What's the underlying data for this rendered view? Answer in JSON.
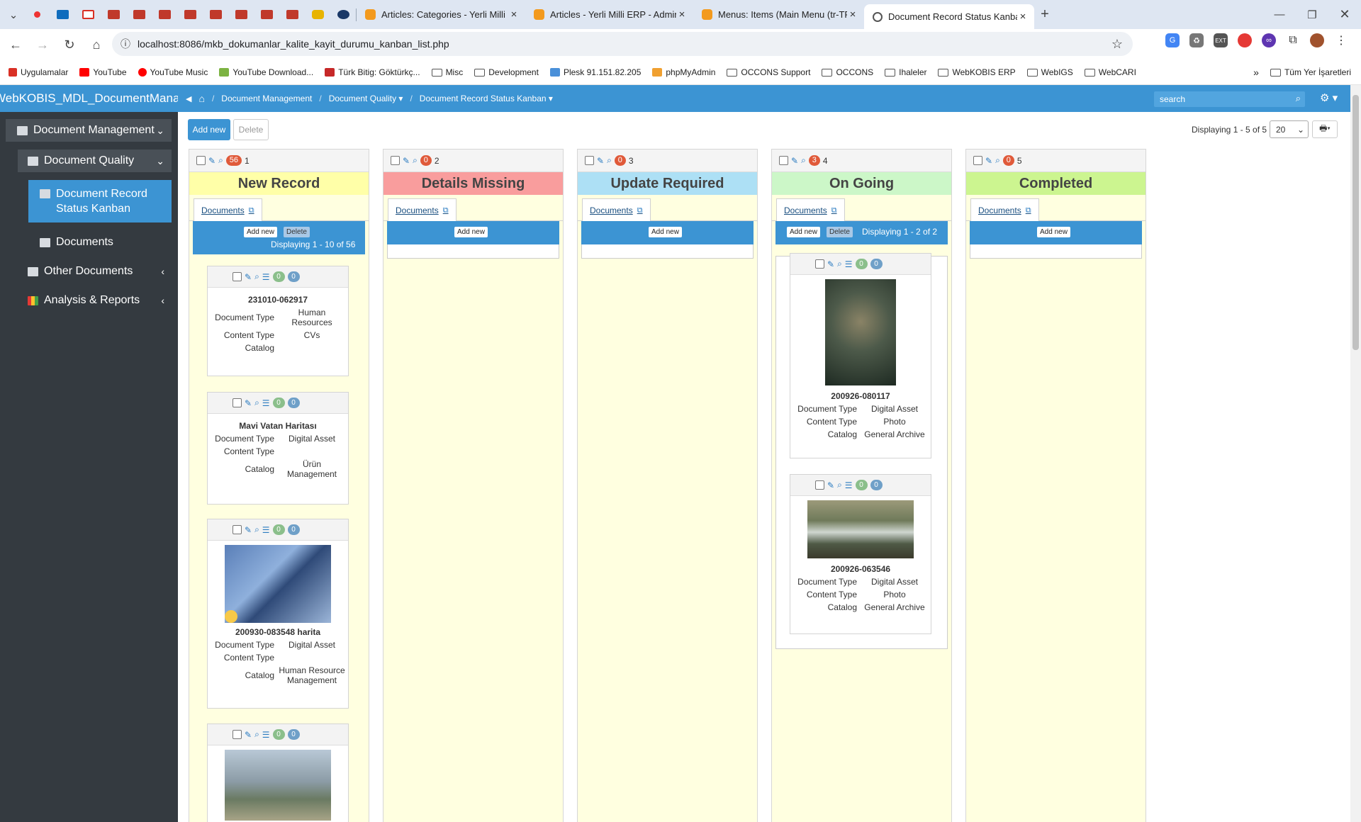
{
  "browser": {
    "tabs": [
      {
        "label": "Articles: Categories - Yerli Milli ERP"
      },
      {
        "label": "Articles - Yerli Milli ERP - Admin"
      },
      {
        "label": "Menus: Items (Main Menu (tr-TR))"
      },
      {
        "label": "Document Record Status Kanban"
      }
    ],
    "new_tab": "+",
    "url": "localhost:8086/mkb_dokumanlar_kalite_kayit_durumu_kanban_list.php"
  },
  "bookmarks": [
    {
      "label": "Uygulamalar"
    },
    {
      "label": "YouTube"
    },
    {
      "label": "YouTube Music"
    },
    {
      "label": "YouTube Download..."
    },
    {
      "label": "Türk Bitig: Göktürkç..."
    },
    {
      "label": "Misc"
    },
    {
      "label": "Development"
    },
    {
      "label": "Plesk 91.151.82.205"
    },
    {
      "label": "phpMyAdmin"
    },
    {
      "label": "OCCONS Support"
    },
    {
      "label": "OCCONS"
    },
    {
      "label": "Ihaleler"
    },
    {
      "label": "WebKOBIS ERP"
    },
    {
      "label": "WebIGS"
    },
    {
      "label": "WebCARI"
    },
    {
      "label": "Tüm Yer İşaretleri"
    }
  ],
  "app": {
    "title": "WebKOBIS_MDL_DocumentManagement",
    "breadcrumbs": [
      "Document Management",
      "Document Quality",
      "Document Record Status Kanban"
    ],
    "search_placeholder": "search"
  },
  "sidebar": {
    "items": [
      {
        "label": "Document Management"
      },
      {
        "label": "Document Quality"
      },
      {
        "label": "Document Record Status Kanban"
      },
      {
        "label": "Documents"
      },
      {
        "label": "Other Documents"
      },
      {
        "label": "Analysis & Reports"
      }
    ]
  },
  "toolbar": {
    "add_new": "Add new",
    "delete": "Delete",
    "displaying": "Displaying 1 - 5 of 5",
    "per_page": "20"
  },
  "columns": [
    {
      "title": "New Record",
      "count": "56",
      "num": "1",
      "color": "#ffffa8",
      "tab": "Documents",
      "add_new": "Add new",
      "delete": "Delete",
      "displaying": "Displaying 1 - 10 of 56"
    },
    {
      "title": "Details Missing",
      "count": "0",
      "num": "2",
      "color": "#f99d9d",
      "tab": "Documents",
      "add_new": "Add new"
    },
    {
      "title": "Update Required",
      "count": "0",
      "num": "3",
      "color": "#ade0f5",
      "tab": "Documents",
      "add_new": "Add new"
    },
    {
      "title": "On Going",
      "count": "3",
      "num": "4",
      "color": "#ccf7c8",
      "tab": "Documents",
      "add_new": "Add new",
      "delete": "Delete",
      "displaying": "Displaying 1 - 2 of 2"
    },
    {
      "title": "Completed",
      "count": "0",
      "num": "5",
      "color": "#ccf590",
      "tab": "Documents",
      "add_new": "Add new"
    }
  ],
  "labels": {
    "document_type": "Document Type",
    "content_type": "Content Type",
    "catalog": "Catalog"
  },
  "cards": [
    {
      "id": "231010-062917",
      "document_type": "Human Resources",
      "content_type": "CVs",
      "catalog": ""
    },
    {
      "id": "Mavi Vatan Haritası",
      "document_type": "Digital Asset",
      "content_type": "",
      "catalog": "Ürün Management"
    },
    {
      "id": "200930-083548 harita",
      "document_type": "Digital Asset",
      "content_type": "",
      "catalog": "Human Resource Management"
    },
    {
      "id": "",
      "document_type": "",
      "content_type": "",
      "catalog": ""
    },
    {
      "id": "200926-080117",
      "document_type": "Digital Asset",
      "content_type": "Photo",
      "catalog": "General Archive"
    },
    {
      "id": "200926-063546",
      "document_type": "Digital Asset",
      "content_type": "Photo",
      "catalog": "General Archive"
    }
  ],
  "badges": {
    "zero": "0"
  }
}
